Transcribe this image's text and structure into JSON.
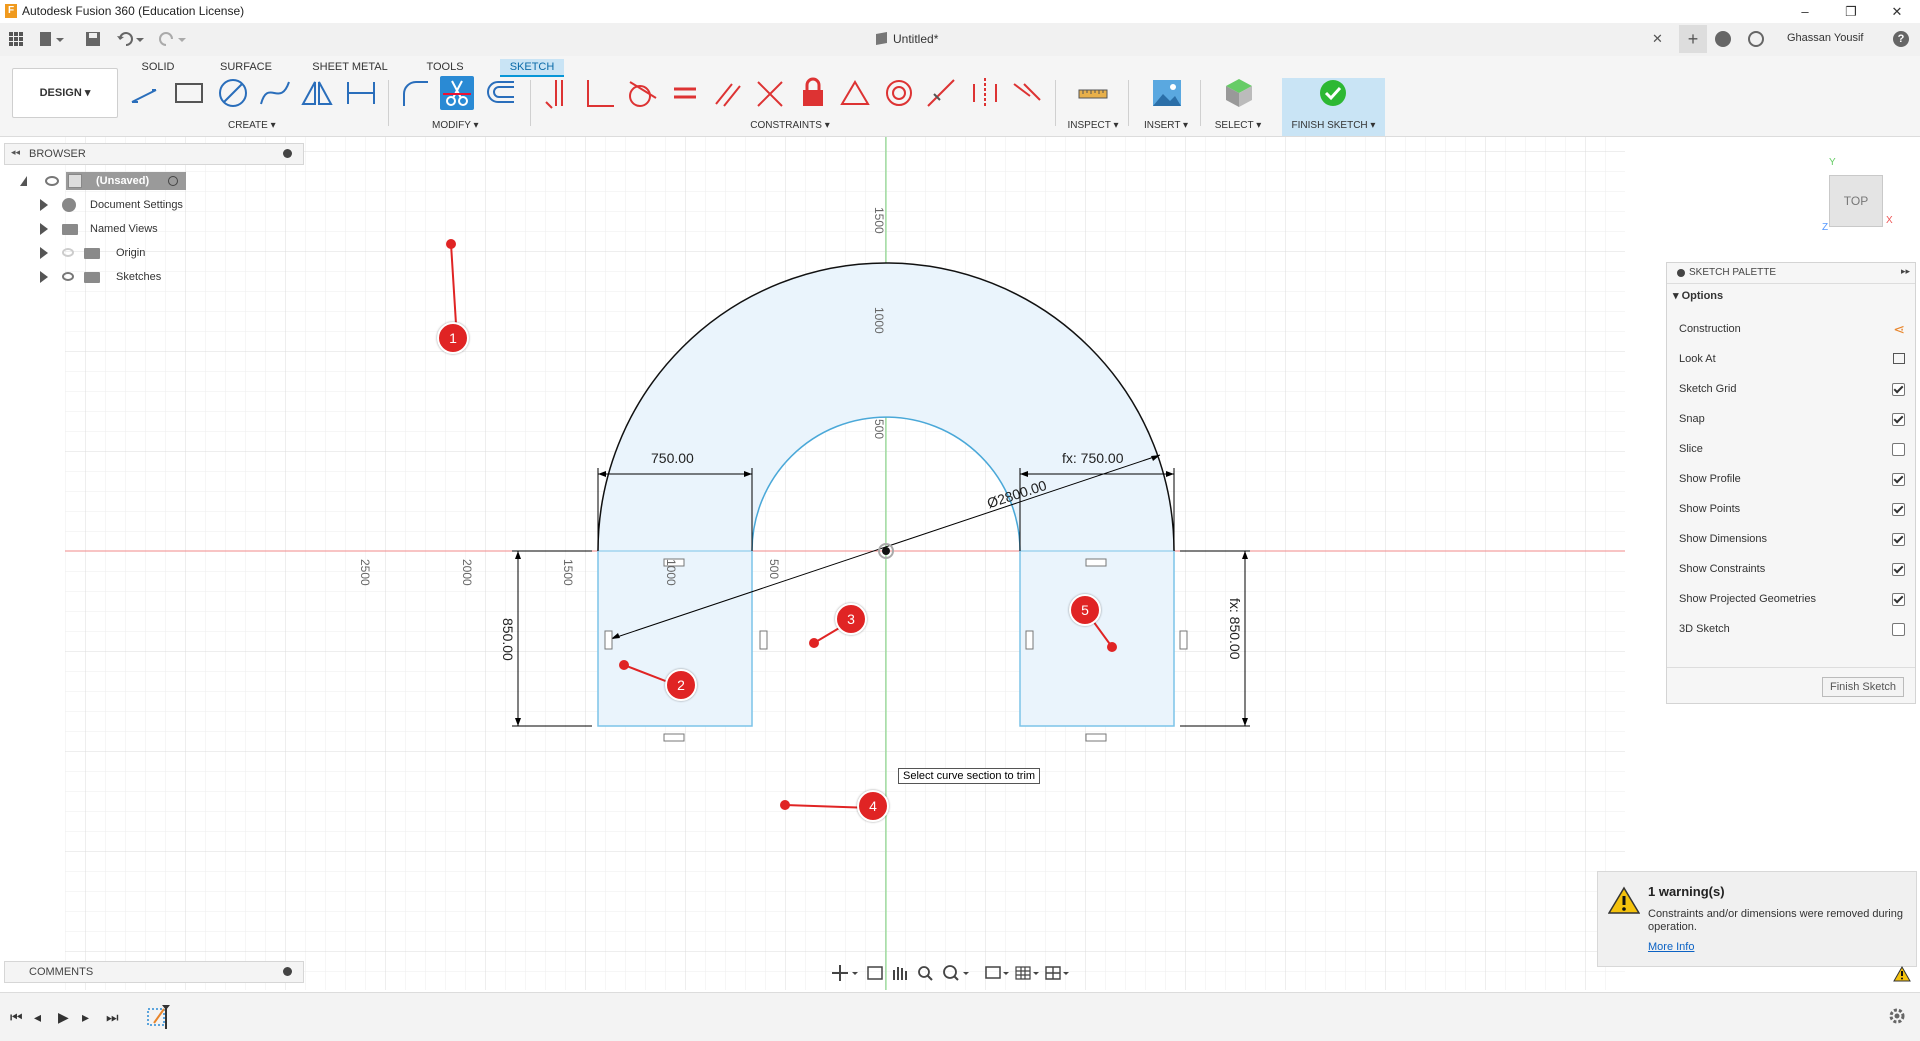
{
  "window": {
    "title": "Autodesk Fusion 360 (Education License)",
    "app_icon_letter": "F",
    "minimize": "–",
    "restore": "❐",
    "close": "✕"
  },
  "appbar": {
    "doc_title": "Untitled*",
    "close_tab": "✕",
    "add_tab": "+",
    "user_name": "Ghassan Yousif",
    "help": "?"
  },
  "workspace_tabs": [
    "SOLID",
    "SURFACE",
    "SHEET METAL",
    "TOOLS",
    "SKETCH"
  ],
  "active_tab": "SKETCH",
  "design_button": "DESIGN ▾",
  "tool_groups": {
    "create": "CREATE ▾",
    "modify": "MODIFY ▾",
    "constraints": "CONSTRAINTS ▾",
    "inspect": "INSPECT ▾",
    "insert": "INSERT ▾",
    "select": "SELECT ▾",
    "finish_sketch": "FINISH SKETCH ▾"
  },
  "browser": {
    "title": "BROWSER",
    "collapse": "◂◂",
    "root": "(Unsaved)",
    "items": [
      "Document Settings",
      "Named Views",
      "Origin",
      "Sketches"
    ]
  },
  "comments": {
    "title": "COMMENTS"
  },
  "viewcube": {
    "face": "TOP",
    "axis_x": "X",
    "axis_y": "Y",
    "axis_z": "Z"
  },
  "sketch_palette": {
    "title": "SKETCH PALETTE",
    "section": "Options",
    "options": [
      {
        "label": "Construction",
        "type": "icon",
        "icon": "construction-icon"
      },
      {
        "label": "Look At",
        "type": "icon",
        "icon": "look-at-icon"
      },
      {
        "label": "Sketch Grid",
        "type": "checkbox",
        "checked": true
      },
      {
        "label": "Snap",
        "type": "checkbox",
        "checked": true
      },
      {
        "label": "Slice",
        "type": "checkbox",
        "checked": false
      },
      {
        "label": "Show Profile",
        "type": "checkbox",
        "checked": true
      },
      {
        "label": "Show Points",
        "type": "checkbox",
        "checked": true
      },
      {
        "label": "Show Dimensions",
        "type": "checkbox",
        "checked": true
      },
      {
        "label": "Show Constraints",
        "type": "checkbox",
        "checked": true
      },
      {
        "label": "Show Projected Geometries",
        "type": "checkbox",
        "checked": true
      },
      {
        "label": "3D Sketch",
        "type": "checkbox",
        "checked": false
      }
    ],
    "finish_button": "Finish Sketch"
  },
  "sketch": {
    "dim_left_width": "750.00",
    "dim_right_width": "fx: 750.00",
    "dim_diameter": "Ø2800.00",
    "dim_left_height": "850.00",
    "dim_right_height": "fx: 850.00",
    "ruler_v": [
      "1500",
      "1000",
      "500"
    ],
    "ruler_h": [
      "2500",
      "2000",
      "1500",
      "1000",
      "500"
    ],
    "tooltip": "Select curve section to trim"
  },
  "callouts": [
    "1",
    "2",
    "3",
    "4",
    "5"
  ],
  "warning": {
    "title": "1 warning(s)",
    "message": "Constraints and/or dimensions were removed during operation.",
    "link": "More Info"
  }
}
